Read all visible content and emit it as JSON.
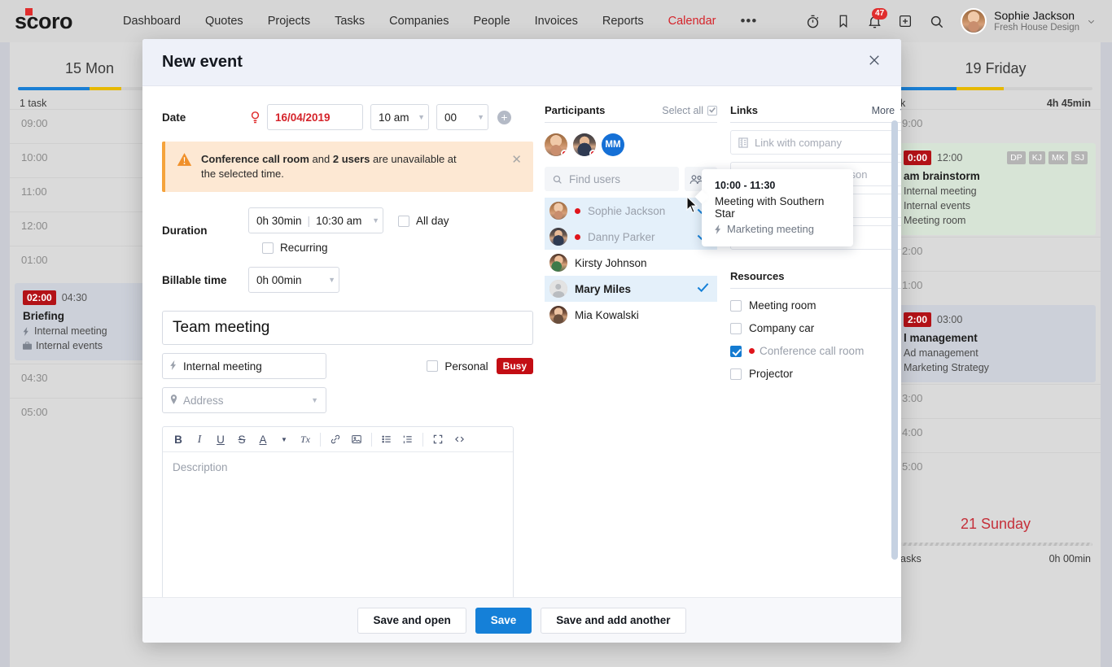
{
  "topbar": {
    "logo_text": "scoro",
    "nav": [
      {
        "label": "Dashboard",
        "active": false
      },
      {
        "label": "Quotes",
        "active": false
      },
      {
        "label": "Projects",
        "active": false
      },
      {
        "label": "Tasks",
        "active": false
      },
      {
        "label": "Companies",
        "active": false
      },
      {
        "label": "People",
        "active": false
      },
      {
        "label": "Invoices",
        "active": false
      },
      {
        "label": "Reports",
        "active": false
      },
      {
        "label": "Calendar",
        "active": true
      }
    ],
    "more_label": "•••",
    "icons": [
      "timer-icon",
      "bookmark-icon",
      "notifications-icon",
      "add-icon",
      "search-icon"
    ],
    "notification_count": "47",
    "user_name": "Sophie Jackson",
    "user_company": "Fresh House Design",
    "accent_red": "#d5232a",
    "accent_blue": "#1580d8"
  },
  "calendar": {
    "left_day": {
      "num": "15",
      "name": "Mon",
      "summary_left": "1 task",
      "summary_right": ""
    },
    "right_day": {
      "num": "19",
      "name": "Friday",
      "summary_left": "k",
      "summary_right": "4h 45min"
    },
    "sunday": {
      "num": "21",
      "name": "Sunday",
      "summary_left": "asks",
      "summary_right": "0h 00min"
    },
    "left_hours": [
      "09:00",
      "10:00",
      "11:00",
      "12:00",
      "01:00"
    ],
    "left_hours_after": [
      "04:30",
      "05:00"
    ],
    "left_event": {
      "start": "02:00",
      "end": "04:30",
      "title": "Briefing",
      "line1": "Internal meeting",
      "line2": "Internal events"
    },
    "right_hours_top": [
      "9:00"
    ],
    "right_event_1": {
      "start": "0:00",
      "end": "12:00",
      "title": "am brainstorm",
      "line1": "Internal meeting",
      "line2": "Internal events",
      "line3": "Meeting room",
      "initials": [
        "DP",
        "KJ",
        "MK",
        "SJ"
      ]
    },
    "right_hours_mid": [
      "2:00",
      "1:00"
    ],
    "right_event_2": {
      "start": "2:00",
      "end": "03:00",
      "title": "l management",
      "line1": "Ad management",
      "line2": "Marketing Strategy"
    },
    "right_hours_bottom": [
      "3:00",
      "4:00",
      "5:00"
    ]
  },
  "modal": {
    "title": "New event",
    "date": {
      "label": "Date",
      "value": "16/04/2019",
      "hour": "10 am",
      "minute": "00"
    },
    "warning": {
      "bold1": "Conference call room",
      "mid": " and ",
      "bold2": "2 users",
      "rest": " are unavailable at the selected time."
    },
    "duration": {
      "label": "Duration",
      "value": "0h 30min",
      "end_time": "10:30 am",
      "all_day_label": "All day",
      "all_day_checked": false,
      "recurring_label": "Recurring",
      "recurring_checked": false
    },
    "billable": {
      "label": "Billable time",
      "value": "0h 00min"
    },
    "event_title": "Team meeting",
    "event_type": "Internal meeting",
    "address_placeholder": "Address",
    "personal_label": "Personal",
    "personal_checked": false,
    "busy_label": "Busy",
    "editor": {
      "tools": [
        "bold-icon",
        "italic-icon",
        "underline-icon",
        "strikethrough-icon",
        "text-color-icon",
        "clear-format-icon",
        "link-icon",
        "image-icon",
        "bullet-list-icon",
        "numbered-list-icon",
        "fullscreen-icon",
        "code-icon"
      ],
      "bold": "B",
      "italic": "I",
      "underline": "U",
      "strike": "S",
      "color": "A",
      "clear": "Tx",
      "description_placeholder": "Description"
    },
    "participants": {
      "title": "Participants",
      "select_all": "Select all",
      "select_all_checked": true,
      "stack_initials": "MM",
      "search_placeholder": "Find users",
      "list": [
        {
          "name": "Sophie Jackson",
          "selected": true,
          "unavailable": true,
          "dim": true,
          "bold": false,
          "avatar": "photo-f"
        },
        {
          "name": "Danny Parker",
          "selected": true,
          "unavailable": true,
          "dim": true,
          "bold": false,
          "avatar": "photo-m"
        },
        {
          "name": "Kirsty Johnson",
          "selected": false,
          "unavailable": false,
          "dim": false,
          "bold": false,
          "avatar": "photo-k"
        },
        {
          "name": "Mary Miles",
          "selected": true,
          "unavailable": false,
          "dim": false,
          "bold": true,
          "avatar": "blank"
        },
        {
          "name": "Mia Kowalski",
          "selected": false,
          "unavailable": false,
          "dim": false,
          "bold": false,
          "avatar": "photo-mia"
        }
      ]
    },
    "links": {
      "title": "Links",
      "more": "More",
      "fields": [
        {
          "placeholder": "Link with company",
          "icon": "company-icon"
        },
        {
          "placeholder": "Link with contact person",
          "icon": "person-icon"
        },
        {
          "placeholder": "",
          "icon": ""
        },
        {
          "placeholder": "",
          "icon": ""
        }
      ]
    },
    "resources": {
      "title": "Resources",
      "items": [
        {
          "label": "Meeting room",
          "checked": false,
          "unavailable": false
        },
        {
          "label": "Company car",
          "checked": false,
          "unavailable": false
        },
        {
          "label": "Conference call room",
          "checked": true,
          "unavailable": true
        },
        {
          "label": "Projector",
          "checked": false,
          "unavailable": false
        }
      ]
    },
    "tooltip": {
      "time": "10:00 - 11:30",
      "title": "Meeting with Southern Star",
      "type": "Marketing meeting"
    },
    "footer": {
      "save_and_open": "Save and open",
      "save": "Save",
      "save_and_add": "Save and add another"
    }
  }
}
